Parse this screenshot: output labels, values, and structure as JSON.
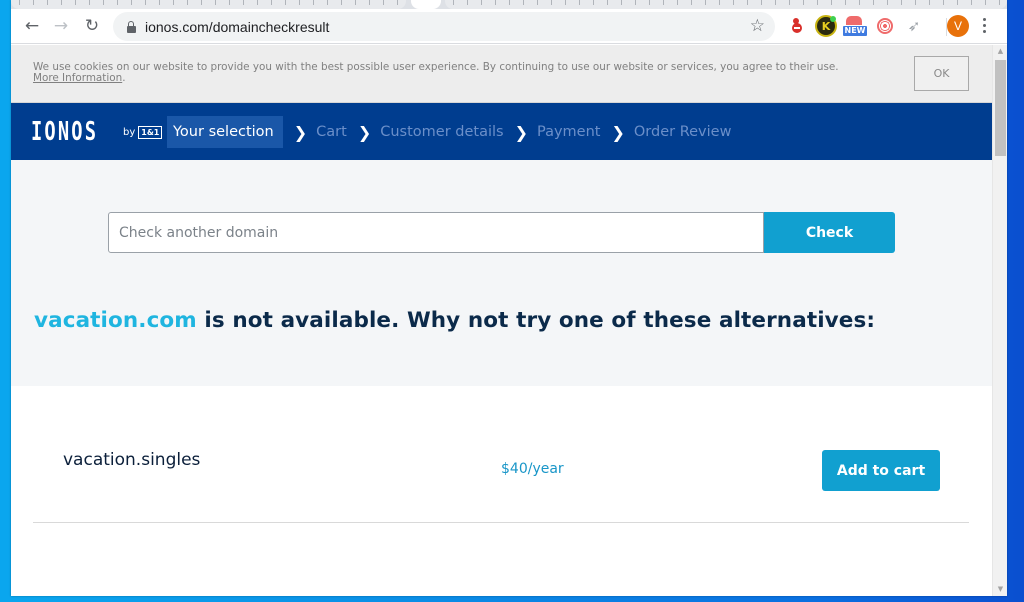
{
  "browser": {
    "url": "ionos.com/domaincheckresult",
    "nav": {
      "back_icon": "arrow-left-icon",
      "forward_icon": "arrow-right-icon",
      "reload_icon": "reload-icon"
    },
    "extensions": [
      {
        "name": "red-blocker-extension",
        "icon": "red-dot-minus-icon"
      },
      {
        "name": "keeper-extension",
        "icon": "keeper-icon",
        "glyph": "K"
      },
      {
        "name": "new-extension",
        "icon": "house-icon",
        "badge": "NEW"
      },
      {
        "name": "target-extension",
        "icon": "target-icon"
      },
      {
        "name": "feather-extension",
        "icon": "feather-icon"
      }
    ],
    "profile_initial": "V"
  },
  "cookie_banner": {
    "text": "We use cookies on our website to provide you with the best possible user experience. By continuing to use our website or services, you agree to their use.",
    "link": "More Information",
    "link_suffix": ".",
    "ok_label": "OK"
  },
  "header": {
    "logo": "IONOS",
    "logo_by": "by",
    "logo_badge": "1&1",
    "steps": [
      {
        "label": "Your selection",
        "active": true
      },
      {
        "label": "Cart",
        "active": false
      },
      {
        "label": "Customer details",
        "active": false
      },
      {
        "label": "Payment",
        "active": false
      },
      {
        "label": "Order Review",
        "active": false
      }
    ],
    "separator": "❯"
  },
  "search": {
    "placeholder": "Check another domain",
    "value": "",
    "button_label": "Check"
  },
  "headline": {
    "domain": "vacation.com",
    "message": " is not available. Why not try one of these alternatives:"
  },
  "colors": {
    "brand_navy": "#003d8f",
    "accent_blue": "#11a0d0",
    "domain_highlight": "#1fb5e0",
    "text_dark": "#0b2a4a"
  },
  "results": [
    {
      "domain": "vacation.singles",
      "price": "$40/year",
      "button_label": "Add to cart"
    }
  ]
}
